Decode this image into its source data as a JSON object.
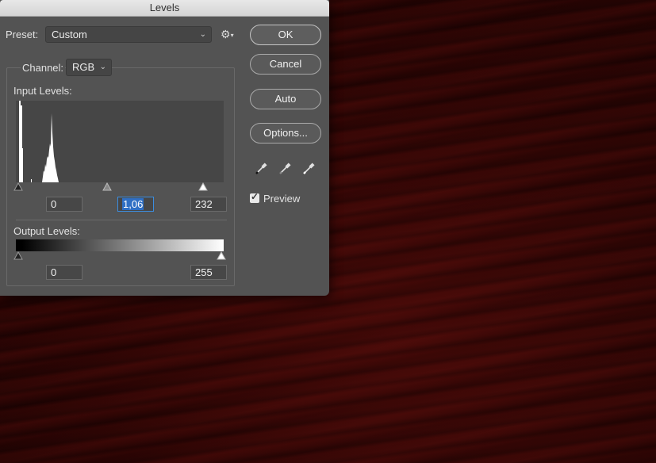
{
  "dialog": {
    "title": "Levels",
    "preset_label": "Preset:",
    "preset_value": "Custom",
    "channel_label": "Channel:",
    "channel_value": "RGB",
    "input_levels_label": "Input Levels:",
    "input_black": "0",
    "input_gamma": "1,06",
    "input_white": "232",
    "output_levels_label": "Output Levels:",
    "output_black": "0",
    "output_white": "255",
    "preview_label": "Preview",
    "preview_checked": true
  },
  "buttons": {
    "ok": "OK",
    "cancel": "Cancel",
    "auto": "Auto",
    "options": "Options..."
  },
  "icons": {
    "preset_menu": "gear-icon",
    "eyedroppers": [
      "black-eyedropper-icon",
      "gray-eyedropper-icon",
      "white-eyedropper-icon"
    ],
    "chevron": "chevron-down-icon"
  },
  "colors": {
    "dialog_bg": "#535353",
    "highlight": "#2f6fc4",
    "background": "#2a0605"
  }
}
